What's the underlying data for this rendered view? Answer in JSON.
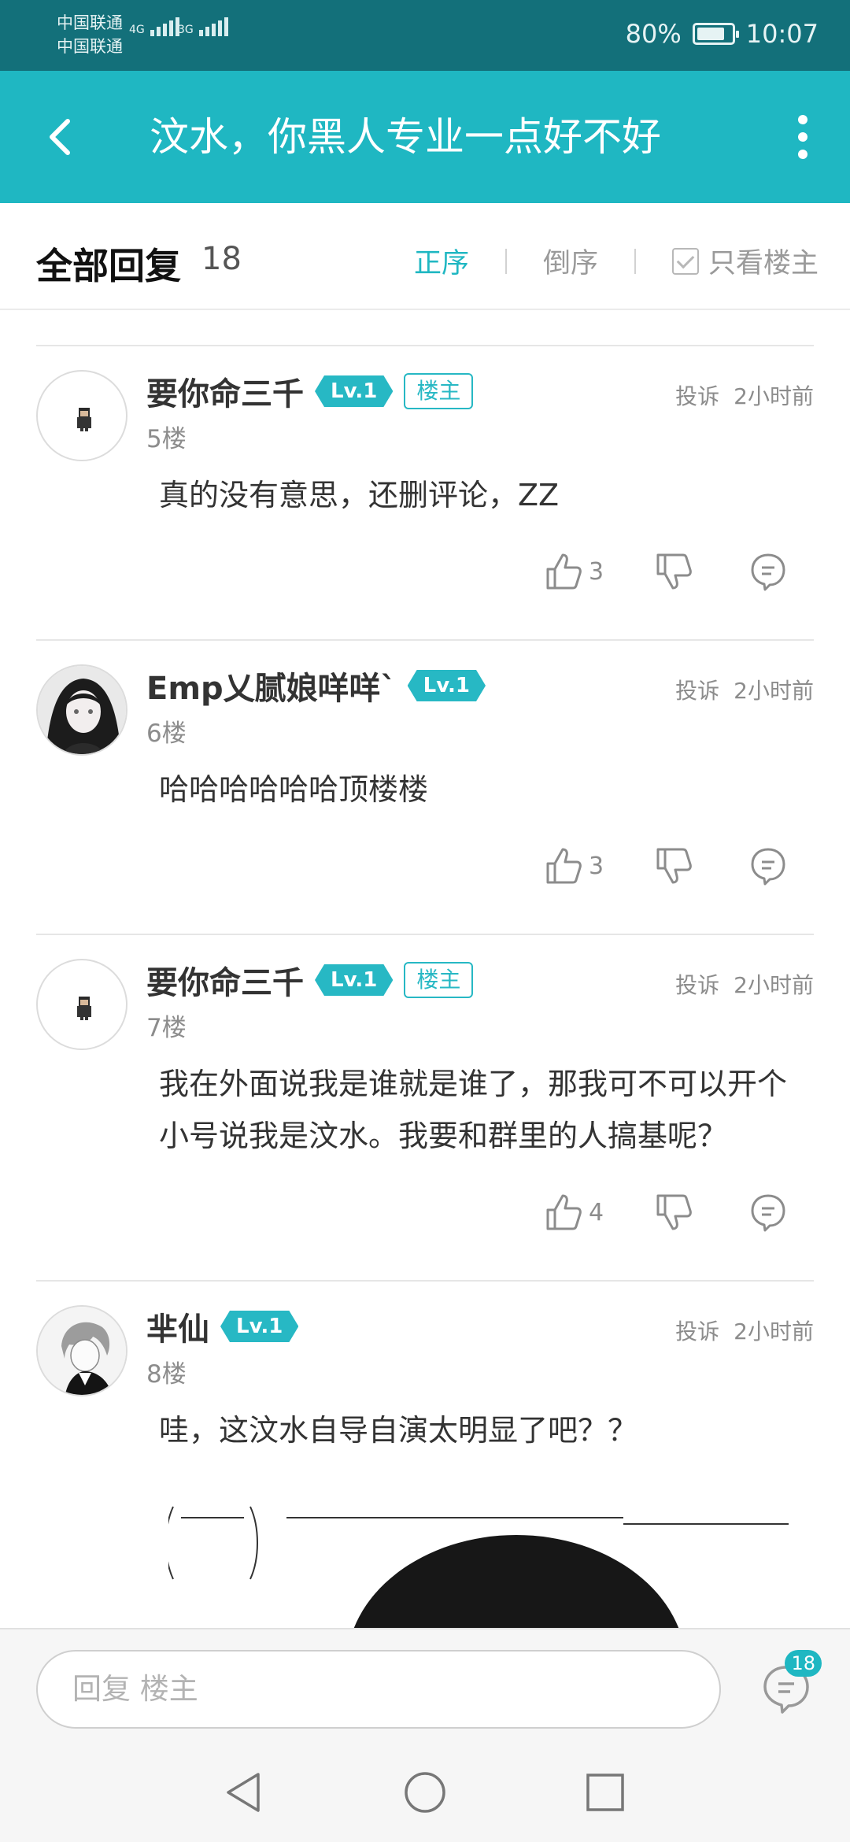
{
  "status_bar": {
    "carrier_1": "中国联通",
    "carrier_2": "中国联通",
    "network_1": "4G",
    "network_2": "3G",
    "battery_percent": "80%",
    "battery_level": 0.8,
    "time": "10:07"
  },
  "title_bar": {
    "title": "汶水，你黑人专业一点好不好",
    "back_icon": "chevron-left-icon",
    "more_icon": "more-vertical-icon"
  },
  "replies_header": {
    "title": "全部回复",
    "count": "18",
    "sort_asc": "正序",
    "sort_desc": "倒序",
    "only_owner": "只看楼主",
    "accent": "#1fb7c2"
  },
  "posts": [
    {
      "username": "要你命三千",
      "level": "Lv.1",
      "owner_badge": "楼主",
      "report": "投诉",
      "time": "2小时前",
      "floor": "5楼",
      "content": "真的没有意思，还删评论，ZZ",
      "likes": "3"
    },
    {
      "username": "Emp乂腻娘咩咩`",
      "level": "Lv.1",
      "report": "投诉",
      "time": "2小时前",
      "floor": "6楼",
      "content": "哈哈哈哈哈哈顶楼楼",
      "likes": "3"
    },
    {
      "username": "要你命三千",
      "level": "Lv.1",
      "owner_badge": "楼主",
      "report": "投诉",
      "time": "2小时前",
      "floor": "7楼",
      "content": "我在外面说我是谁就是谁了，那我可不可以开个小号说我是汶水。我要和群里的人搞基呢？",
      "likes": "4"
    },
    {
      "username": "芈仙",
      "level": "Lv.1",
      "report": "投诉",
      "time": "2小时前",
      "floor": "8楼",
      "content": "哇，这汶水自导自演太明显了吧？？"
    }
  ],
  "reply_bar": {
    "placeholder": "回复  楼主",
    "comment_count": "18"
  },
  "nav_bar": {
    "back": "triangle-back-icon",
    "home": "circle-home-icon",
    "recents": "square-recents-icon"
  }
}
